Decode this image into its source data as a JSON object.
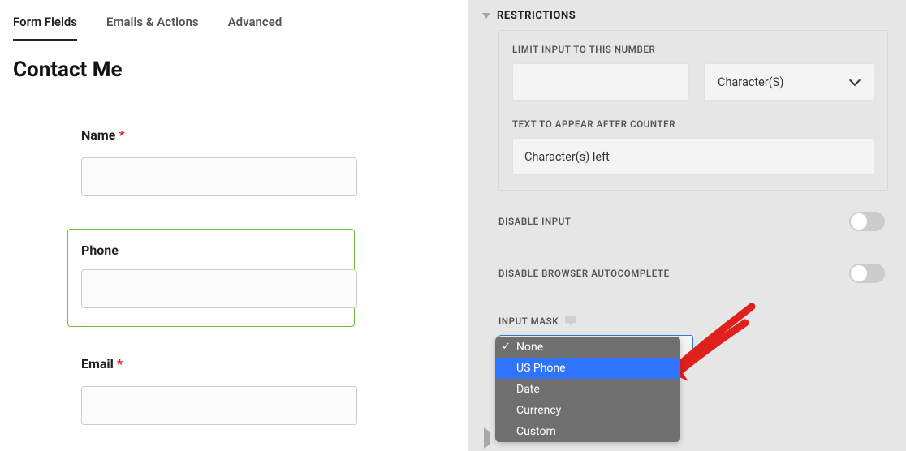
{
  "tabs": {
    "form_fields": "Form Fields",
    "emails_actions": "Emails & Actions",
    "advanced": "Advanced"
  },
  "form": {
    "title": "Contact Me",
    "fields": {
      "name": {
        "label": "Name",
        "required": "*"
      },
      "phone": {
        "label": "Phone"
      },
      "email": {
        "label": "Email",
        "required": "*"
      }
    }
  },
  "sidebar": {
    "restrictions_header": "RESTRICTIONS",
    "limit_label": "LIMIT INPUT TO THIS NUMBER",
    "limit_unit": "Character(S)",
    "counter_label": "TEXT TO APPEAR AFTER COUNTER",
    "counter_value": "Character(s) left",
    "disable_input": "DISABLE INPUT",
    "disable_autocomplete": "DISABLE BROWSER AUTOCOMPLETE",
    "input_mask_label": "INPUT MASK",
    "mask_options": {
      "none": "None",
      "us_phone": "US Phone",
      "date": "Date",
      "currency": "Currency",
      "custom": "Custom"
    }
  }
}
